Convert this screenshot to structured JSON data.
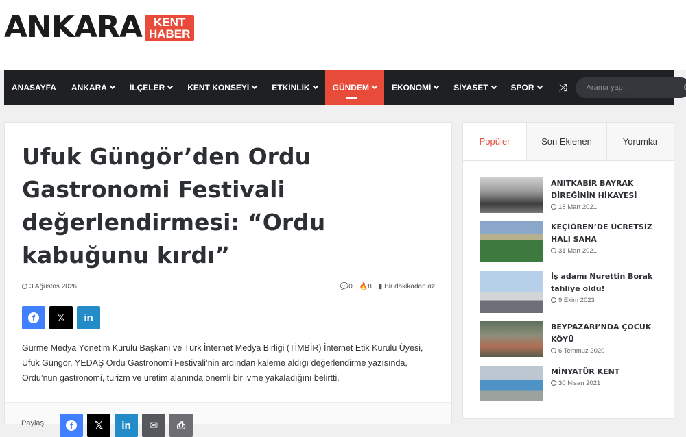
{
  "logo": {
    "main": "ANKARA",
    "badge_line1": "KENT",
    "badge_line2": "HABER"
  },
  "nav": {
    "items": [
      {
        "label": "ANASAYFA",
        "dropdown": false
      },
      {
        "label": "ANKARA",
        "dropdown": true
      },
      {
        "label": "İLÇELER",
        "dropdown": true
      },
      {
        "label": "KENT KONSEYİ",
        "dropdown": true
      },
      {
        "label": "ETKİNLİK",
        "dropdown": true
      },
      {
        "label": "GÜNDEM",
        "dropdown": true,
        "active": true
      },
      {
        "label": "EKONOMİ",
        "dropdown": true
      },
      {
        "label": "SİYASET",
        "dropdown": true
      },
      {
        "label": "SPOR",
        "dropdown": true
      }
    ],
    "search_placeholder": "Arama yap ..."
  },
  "article": {
    "title": "Ufuk Güngör’den Ordu Gastronomi Festivali değerlendirmesi: “Ordu kabuğunu kırdı”",
    "date": "3 Ağustos 2026",
    "comments": "0",
    "views": "8",
    "read_time": "Bir dakikadan az",
    "body": "Gurme Medya Yönetim Kurulu Başkanı ve Türk İnternet Medya Birliği (TİMBİR) İnternet Etik Kurulu Üyesi, Ufuk Güngör, YEDAŞ Ordu Gastronomi Festivali’nin ardından kaleme aldığı değerlendirme yazısında, Ordu’nun gastronomi, turizm ve üretim alanında önemli bir ivme yakaladığını belirtti.",
    "share_label": "Paylaş"
  },
  "sidebar": {
    "tabs": [
      "Popüler",
      "Son Eklenen",
      "Yorumlar"
    ],
    "posts": [
      {
        "title": "ANITKABİR BAYRAK DİREĞİNİN HİKAYESİ",
        "date": "18 Mart 2021"
      },
      {
        "title": "KEÇİÖREN’DE ÜCRETSİZ HALI SAHA",
        "date": "31 Mart 2021"
      },
      {
        "title": "İş adamı Nurettin Borak tahliye oldu!",
        "date": "9 Ekim 2023"
      },
      {
        "title": "BEYPAZARI’NDA ÇOCUK KÖYÜ",
        "date": "6 Temmuz 2020"
      },
      {
        "title": "MİNYATÜR KENT",
        "date": "30 Nisan 2021"
      }
    ]
  },
  "colors": {
    "accent": "#e84b3a",
    "nav_bg": "#1f2024",
    "facebook": "#4080ff",
    "linkedin": "#238cc8"
  }
}
